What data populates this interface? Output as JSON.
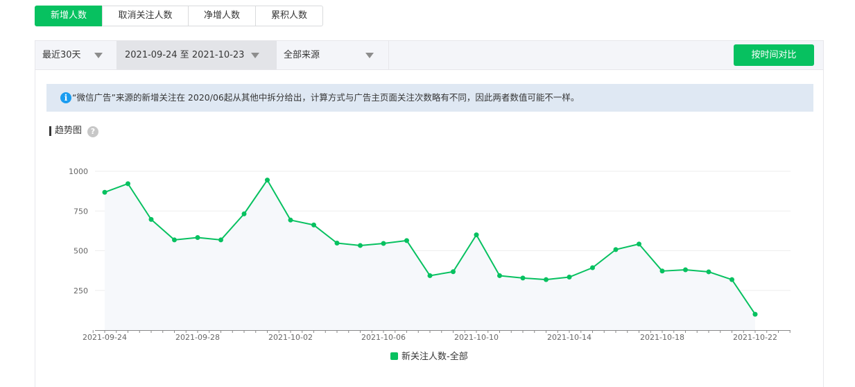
{
  "tabs": [
    "新增人数",
    "取消关注人数",
    "净增人数",
    "累积人数"
  ],
  "toolbar": {
    "period": "最近30天",
    "date_range": "2021-09-24 至 2021-10-23",
    "source": "全部来源",
    "compare_button": "按时间对比"
  },
  "notice": "“微信广告”来源的新增关注在 2020/06起从其他中拆分给出，计算方式与广告主页面关注次数略有不同，因此两者数值可能不一样。",
  "section_title": "趋势图",
  "help_symbol": "?",
  "info_symbol": "i",
  "colors": {
    "accent": "#07c160",
    "series": "#07c160",
    "notice_bg": "#dfe8f3"
  },
  "chart_data": {
    "type": "line",
    "x": [
      "2021-09-24",
      "2021-09-25",
      "2021-09-26",
      "2021-09-27",
      "2021-09-28",
      "2021-09-29",
      "2021-09-30",
      "2021-10-01",
      "2021-10-02",
      "2021-10-03",
      "2021-10-04",
      "2021-10-05",
      "2021-10-06",
      "2021-10-07",
      "2021-10-08",
      "2021-10-09",
      "2021-10-10",
      "2021-10-11",
      "2021-10-12",
      "2021-10-13",
      "2021-10-14",
      "2021-10-15",
      "2021-10-16",
      "2021-10-17",
      "2021-10-18",
      "2021-10-19",
      "2021-10-20",
      "2021-10-21",
      "2021-10-22"
    ],
    "x_tick_labels": [
      "2021-09-24",
      "2021-09-28",
      "2021-10-02",
      "2021-10-06",
      "2021-10-10",
      "2021-10-14",
      "2021-10-18",
      "2021-10-22"
    ],
    "series": [
      {
        "name": "新关注人数-全部",
        "values": [
          868,
          922,
          697,
          568,
          583,
          568,
          732,
          945,
          693,
          662,
          548,
          533,
          546,
          564,
          343,
          368,
          600,
          343,
          328,
          318,
          334,
          393,
          507,
          542,
          372,
          380,
          367,
          318,
          100
        ]
      }
    ],
    "yticks": [
      250,
      500,
      750,
      1000
    ],
    "ylim": [
      0,
      1000
    ],
    "grid": true,
    "legend_position": "bottom-center"
  }
}
